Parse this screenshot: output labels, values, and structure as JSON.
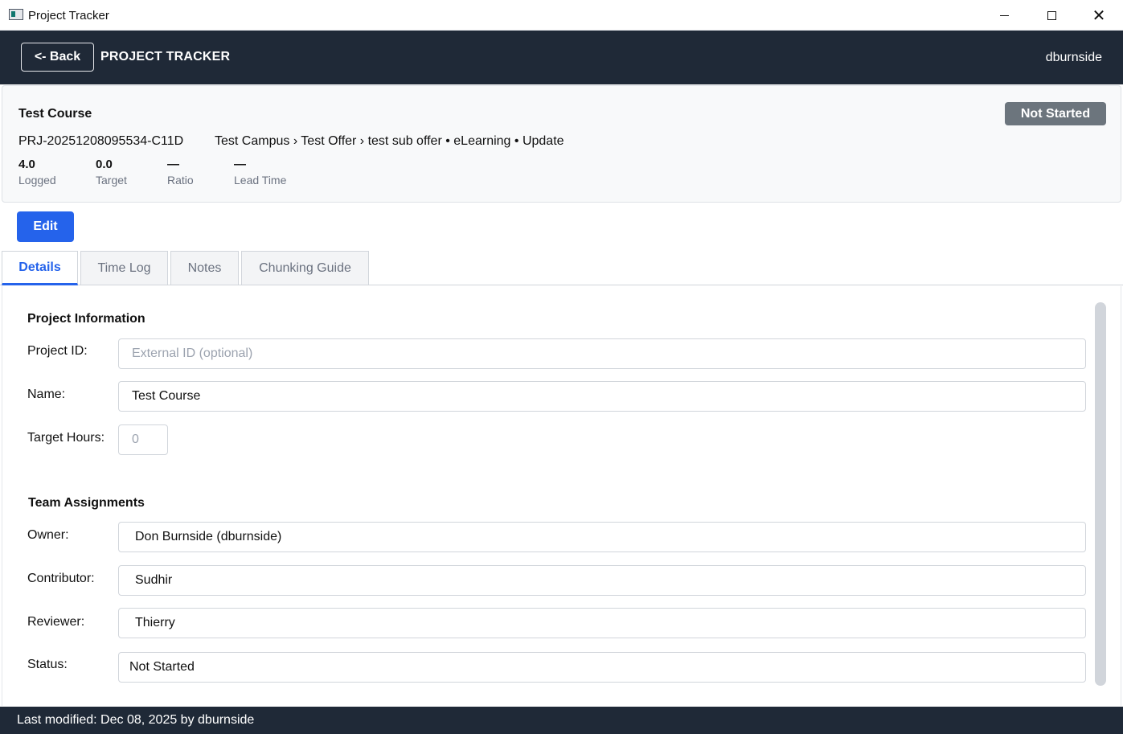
{
  "window": {
    "title": "Project Tracker"
  },
  "header": {
    "back_label": "<- Back",
    "app_name": "PROJECT TRACKER",
    "user": "dburnside"
  },
  "project": {
    "name": "Test Course",
    "status": "Not Started",
    "code": "PRJ-20251208095534-C11D",
    "path": "Test Campus › Test Offer › test sub offer • eLearning • Update",
    "metrics": [
      {
        "value": "4.0",
        "label": "Logged"
      },
      {
        "value": "0.0",
        "label": "Target"
      },
      {
        "value": "—",
        "label": "Ratio"
      },
      {
        "value": "—",
        "label": "Lead Time"
      }
    ]
  },
  "actions": {
    "edit_label": "Edit"
  },
  "tabs": [
    "Details",
    "Time Log",
    "Notes",
    "Chunking Guide"
  ],
  "details": {
    "project_info": {
      "title": "Project Information",
      "project_id_label": "Project ID:",
      "project_id_placeholder": "External ID (optional)",
      "name_label": "Name:",
      "name_value": "Test Course",
      "target_hours_label": "Target Hours:",
      "target_hours_placeholder": "0"
    },
    "team": {
      "title": "Team Assignments",
      "owner_label": "Owner:",
      "owner_value": "Don Burnside (dburnside)",
      "contributor_label": "Contributor:",
      "contributor_value": "Sudhir",
      "reviewer_label": "Reviewer:",
      "reviewer_value": "Thierry",
      "status_label": "Status:",
      "status_value": "Not Started"
    }
  },
  "footer": {
    "text": "Last modified: Dec 08, 2025 by dburnside"
  },
  "colors": {
    "header_bg": "#1f2937",
    "accent": "#2563eb",
    "status_badge": "#6c757d"
  }
}
